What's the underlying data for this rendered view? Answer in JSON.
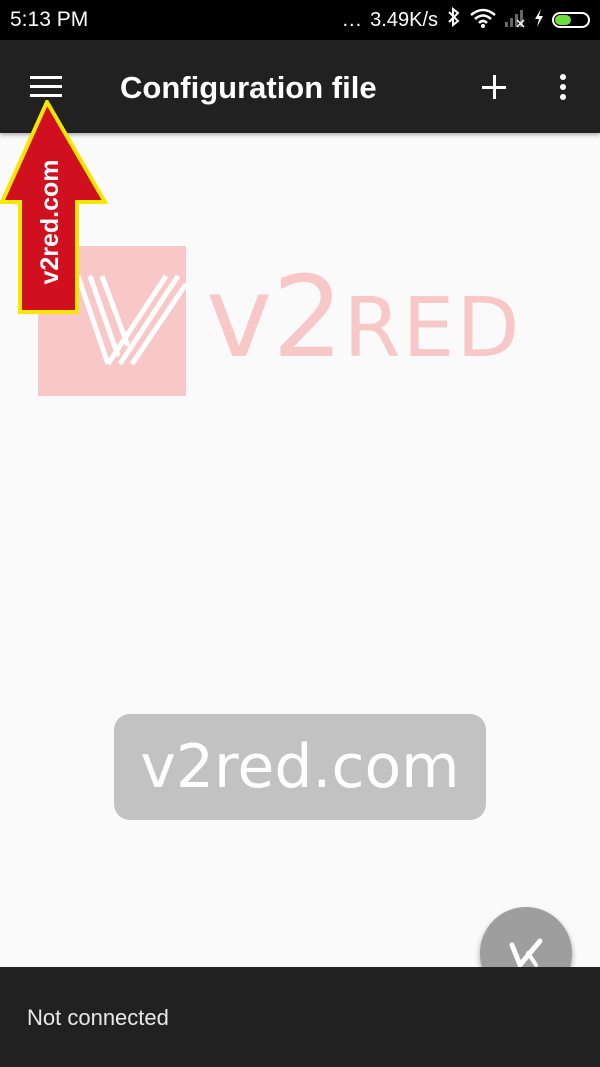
{
  "status_bar": {
    "time": "5:13 PM",
    "dots": "...",
    "speed": "3.49K/s",
    "icons": [
      "bluetooth-icon",
      "wifi-icon",
      "signal-icon",
      "charging-icon",
      "battery-icon"
    ]
  },
  "app_bar": {
    "title": "Configuration file",
    "icons": [
      "menu-icon",
      "add-icon",
      "more-vert-icon"
    ]
  },
  "watermarks": {
    "arrow_text": "v2red.com",
    "logo_v2": "v2",
    "logo_red": "RED",
    "center_text": "v2red.com"
  },
  "fab": {
    "icon": "v-logo-icon"
  },
  "bottom_bar": {
    "status": "Not connected"
  },
  "colors": {
    "app_bar": "#212121",
    "background": "#fafafa",
    "watermark_pink": "#f8c8c8",
    "arrow_red": "#d00f1f",
    "arrow_outline": "#f5e700",
    "fab": "#9e9e9e",
    "battery": "#6fdc3c"
  }
}
